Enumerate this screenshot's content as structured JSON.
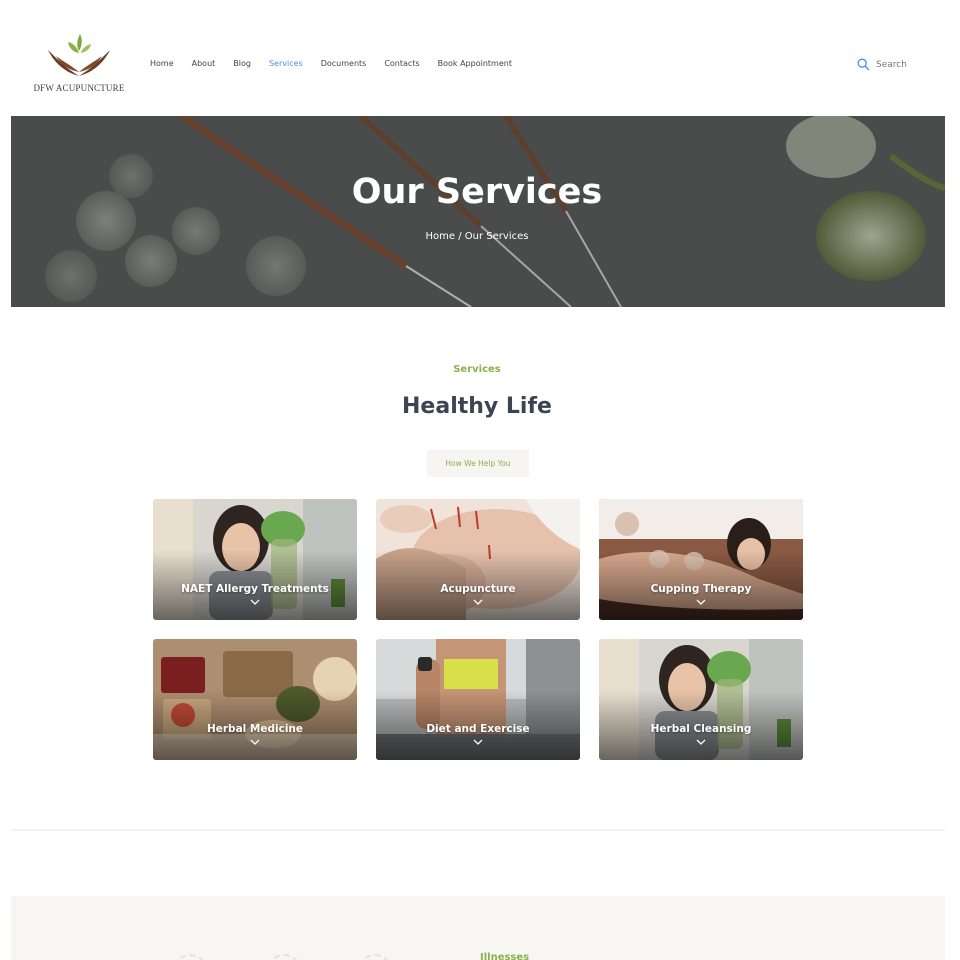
{
  "brand": {
    "name": "DFW ACUPUNCTURE"
  },
  "nav": {
    "items": [
      {
        "label": "Home"
      },
      {
        "label": "About"
      },
      {
        "label": "Blog"
      },
      {
        "label": "Services"
      },
      {
        "label": "Documents"
      },
      {
        "label": "Contacts"
      },
      {
        "label": "Book Appointment"
      }
    ],
    "active": "Services"
  },
  "search": {
    "label": "Search"
  },
  "hero": {
    "title": "Our Services",
    "breadcrumb": "Home / Our Services"
  },
  "section": {
    "eyebrow": "Services",
    "title": "Healthy Life",
    "button": "How We Help You"
  },
  "cards": [
    {
      "label": "NAET Allergy Treatments"
    },
    {
      "label": "Acupuncture"
    },
    {
      "label": "Cupping Therapy"
    },
    {
      "label": "Herbal Medicine"
    },
    {
      "label": "Diet and Exercise"
    },
    {
      "label": "Herbal Cleansing"
    }
  ],
  "next_section": {
    "eyebrow": "Illnesses"
  },
  "colors": {
    "accent_green": "#8bb04a",
    "accent_blue": "#4a90e2",
    "heading": "#3b4450"
  }
}
